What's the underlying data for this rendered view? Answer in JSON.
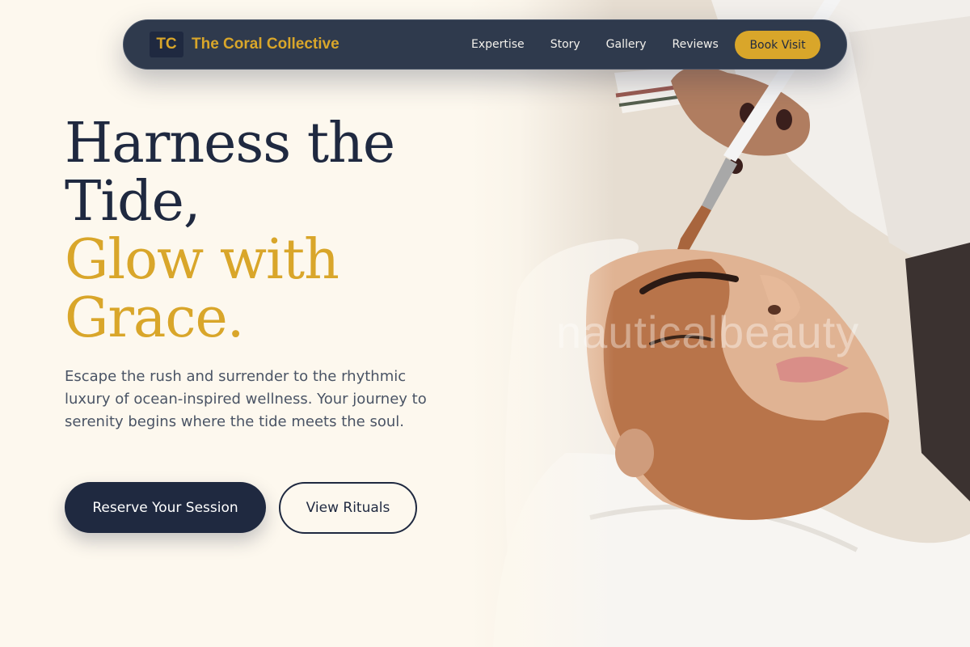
{
  "nav": {
    "brand_initials": "TC",
    "brand_name": "The Coral Collective",
    "links": [
      "Expertise",
      "Story",
      "Gallery",
      "Reviews"
    ],
    "cta_label": "Book Visit"
  },
  "hero": {
    "headline_line1": "Harness the",
    "headline_line2": "Tide,",
    "headline_line3": "Glow with",
    "headline_line4": "Grace.",
    "description": "Escape the rush and surrender to the rhythmic luxury of ocean-inspired wellness. Your journey to serenity begins where the tide meets the soul.",
    "primary_button": "Reserve Your Session",
    "secondary_button": "View Rituals",
    "image_watermark": "nauticalbeauty"
  },
  "colors": {
    "navy": "#1f2940",
    "gold": "#d9a62a",
    "cream": "#fdf8ee"
  }
}
